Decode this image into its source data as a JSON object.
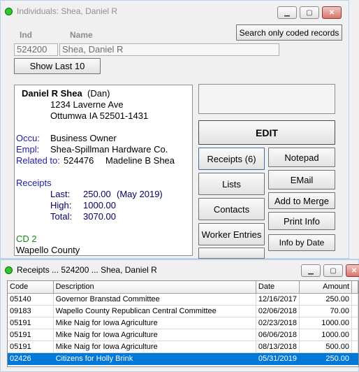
{
  "individual_window": {
    "title": "Individuals: Shea, Daniel R",
    "labels": {
      "ind": "Ind",
      "name": "Name"
    },
    "search_button": "Search only coded records",
    "ind_value": "524200",
    "name_value": "Shea, Daniel R",
    "show_last_button": "Show Last 10",
    "card": {
      "name_bold": "Daniel R Shea",
      "nickname": "(Dan)",
      "address1": "1234 Laverne Ave",
      "address2": "Ottumwa  IA  52501-1431",
      "occu_label": "Occu:",
      "occu_value": "Business Owner",
      "empl_label": "Empl:",
      "empl_value": "Shea-Spillman Hardware Co.",
      "related_label": "Related to:",
      "related_id": "524476",
      "related_name": "Madeline B Shea",
      "receipts_heading": "Receipts",
      "last_label": "Last:",
      "last_value": "250.00",
      "last_date": "(May 2019)",
      "high_label": "High:",
      "high_value": "1000.00",
      "total_label": "Total:",
      "total_value": "3070.00",
      "cd_label": "CD 2",
      "county": "Wapello County"
    },
    "buttons": {
      "edit": "EDIT",
      "receipts": "Receipts (6)",
      "notepad": "Notepad",
      "email": "EMail",
      "lists": "Lists",
      "add_to_merge": "Add to Merge",
      "contacts": "Contacts",
      "print_info": "Print Info",
      "worker_entries": "Worker Entries",
      "info_by_date": "Info by Date"
    }
  },
  "receipts_window": {
    "title": "Receipts ... 524200 ... Shea, Daniel R",
    "columns": [
      "Code",
      "Description",
      "Date",
      "Amount"
    ],
    "rows": [
      [
        "05140",
        "Governor Branstad Committee",
        "12/16/2017",
        "250.00"
      ],
      [
        "09183",
        "Wapello County Republican Central Committee",
        "02/06/2018",
        "70.00"
      ],
      [
        "05191",
        "Mike Naig for Iowa Agriculture",
        "02/23/2018",
        "1000.00"
      ],
      [
        "05191",
        "Mike Naig for Iowa Agriculture",
        "06/06/2018",
        "1000.00"
      ],
      [
        "05191",
        "Mike Naig for Iowa Agriculture",
        "08/13/2018",
        "500.00"
      ],
      [
        "02426",
        "Citizens for Holly Brink",
        "05/31/2019",
        "250.00"
      ]
    ],
    "selected_row": 5
  },
  "colors": {
    "title_dot": "#2fc82f",
    "selection": "#0078d7",
    "label_blue": "#1d1db0",
    "cd_green": "#138a13"
  },
  "icons": [
    "status-dot-icon",
    "minimize-icon",
    "maximize-icon",
    "close-icon"
  ]
}
